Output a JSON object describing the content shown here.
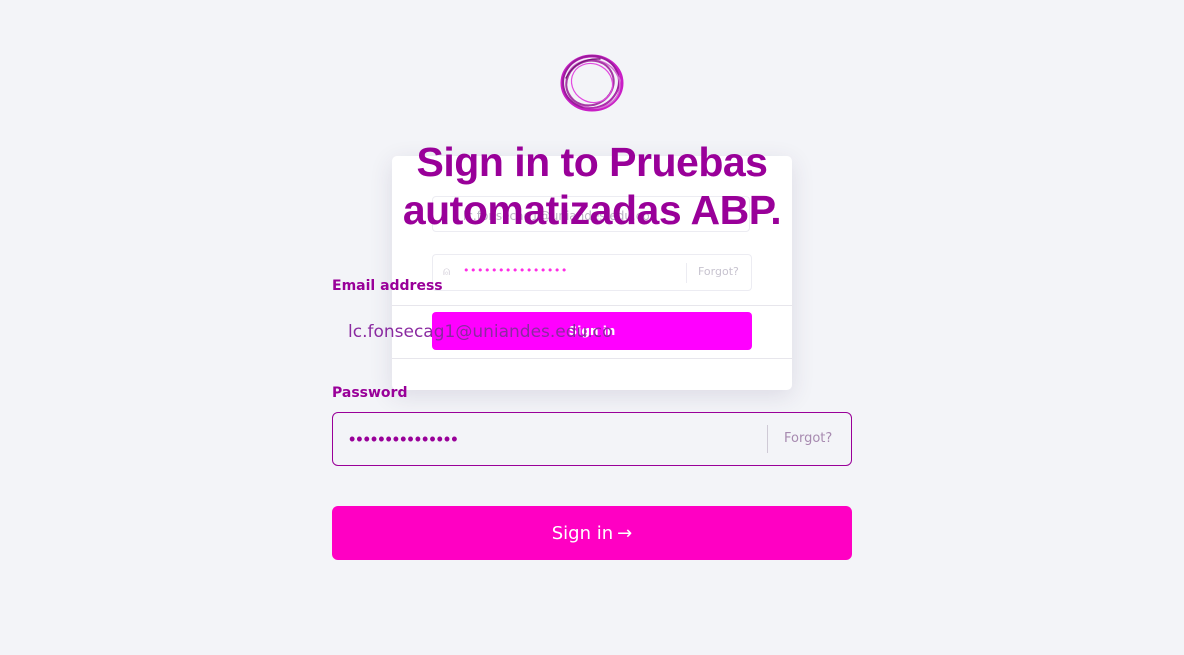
{
  "brand": {
    "logo_icon": "circle-swirl-logo-icon",
    "accent_color": "#990099",
    "button_color": "#ff00c3",
    "ghost_button_color": "#ff00ff",
    "background_color": "#f3f4f8"
  },
  "heading": {
    "line1": "Sign in to Pruebas",
    "line2": "automatizadas ABP."
  },
  "ghost_card": {
    "email_value": "lc.fonsecag1@uniandes.edu.co",
    "lock_icon": "lock-icon",
    "password_mask": "•••••••••••••••",
    "forgot_label": "Forgot?",
    "button_label": "Sign in"
  },
  "form": {
    "email": {
      "label": "Email address",
      "value": "lc.fonsecag1@uniandes.edu.co"
    },
    "password": {
      "label": "Password",
      "value": "•••••••••••••••",
      "forgot_label": "Forgot?"
    },
    "submit": {
      "label": "Sign in",
      "arrow": "→",
      "arrow_icon": "arrow-right-icon"
    }
  }
}
